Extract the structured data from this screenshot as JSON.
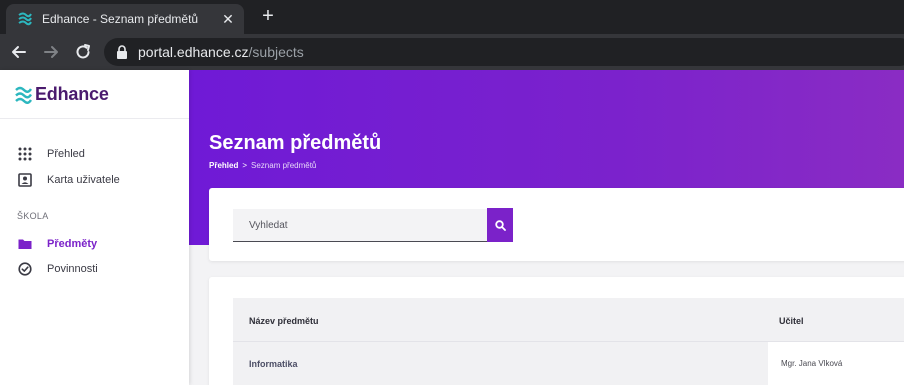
{
  "browser": {
    "tab_title": "Edhance - Seznam předmětů",
    "close_glyph": "✕",
    "new_tab_glyph": "+",
    "url_host": "portal.edhance.cz",
    "url_path": "/subjects"
  },
  "sidebar": {
    "logo_text": "Edhance",
    "items": [
      {
        "label": "Přehled",
        "icon": "grid-icon"
      },
      {
        "label": "Karta uživatele",
        "icon": "user-card-icon"
      }
    ],
    "section_label": "ŠKOLA",
    "school_items": [
      {
        "label": "Předměty",
        "icon": "folder-icon",
        "active": true
      },
      {
        "label": "Povinnosti",
        "icon": "check-circle-icon"
      }
    ]
  },
  "page": {
    "title": "Seznam předmětů",
    "breadcrumb": {
      "first": "Přehled",
      "separator": ">",
      "current": "Seznam předmětů"
    }
  },
  "search": {
    "placeholder": "Vyhledat",
    "button_icon": "search-icon"
  },
  "table": {
    "columns": [
      "Název předmětu",
      "Učitel"
    ],
    "rows": [
      {
        "name": "Informatika",
        "teacher": "Mgr. Jana Vlková"
      }
    ]
  },
  "colors": {
    "accent": "#7b22c9",
    "logo": "#4a1a6e",
    "logo_mark": "#2cb7bf"
  }
}
